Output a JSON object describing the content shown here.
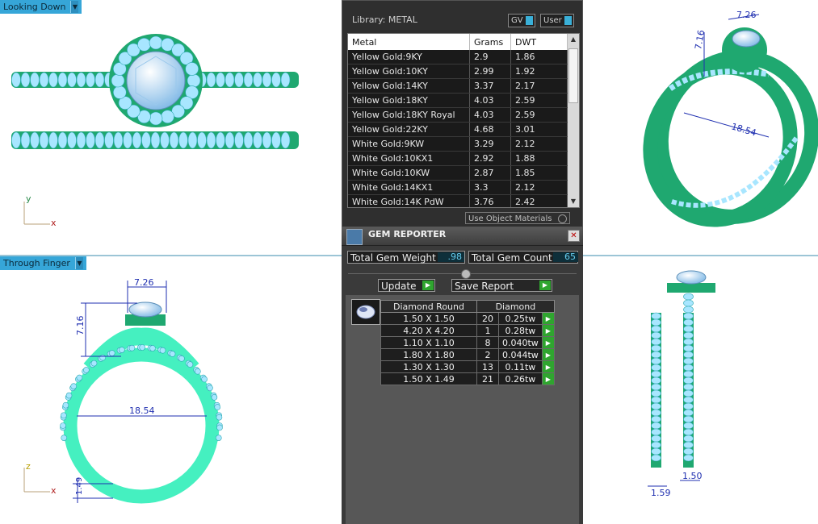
{
  "viewports": {
    "top_left": {
      "label": "Looking Down"
    },
    "bottom_left": {
      "label": "Through Finger"
    },
    "axes_top": {
      "y": "y",
      "x": "x"
    },
    "axes_bottom": {
      "z": "z",
      "x": "x"
    }
  },
  "dimensions": {
    "width": "7.26",
    "height": "7.16",
    "inner": "18.54",
    "thickness": "1.49",
    "band1": "1.59",
    "band2": "1.50"
  },
  "library": {
    "title": "Library: METAL",
    "gv_label": "GV",
    "user_label": "User",
    "columns": [
      "Metal",
      "Grams",
      "DWT"
    ],
    "rows": [
      {
        "metal": "Yellow Gold:9KY",
        "grams": "2.9",
        "dwt": "1.86"
      },
      {
        "metal": "Yellow Gold:10KY",
        "grams": "2.99",
        "dwt": "1.92"
      },
      {
        "metal": "Yellow Gold:14KY",
        "grams": "3.37",
        "dwt": "2.17"
      },
      {
        "metal": "Yellow Gold:18KY",
        "grams": "4.03",
        "dwt": "2.59"
      },
      {
        "metal": "Yellow Gold:18KY Royal",
        "grams": "4.03",
        "dwt": "2.59"
      },
      {
        "metal": "Yellow Gold:22KY",
        "grams": "4.68",
        "dwt": "3.01"
      },
      {
        "metal": "White Gold:9KW",
        "grams": "3.29",
        "dwt": "2.12"
      },
      {
        "metal": "White Gold:10KX1",
        "grams": "2.92",
        "dwt": "1.88"
      },
      {
        "metal": "White Gold:10KW",
        "grams": "2.87",
        "dwt": "1.85"
      },
      {
        "metal": "White Gold:14KX1",
        "grams": "3.3",
        "dwt": "2.12"
      },
      {
        "metal": "White Gold:14K PdW",
        "grams": "3.76",
        "dwt": "2.42"
      }
    ],
    "use_object_materials": "Use Object Materials"
  },
  "gem_reporter": {
    "title": "GEM REPORTER",
    "total_weight_label": "Total Gem Weight",
    "total_weight_value": ".98",
    "total_count_label": "Total Gem Count",
    "total_count_value": "65",
    "update_label": "Update",
    "save_report_label": "Save Report",
    "columns": [
      "Diamond Round",
      "Diamond"
    ],
    "rows": [
      {
        "size": "1.50 X 1.50",
        "count": "20",
        "weight": "0.25tw"
      },
      {
        "size": "4.20 X 4.20",
        "count": "1",
        "weight": "0.28tw"
      },
      {
        "size": "1.10 X 1.10",
        "count": "8",
        "weight": "0.040tw"
      },
      {
        "size": "1.80 X 1.80",
        "count": "2",
        "weight": "0.044tw"
      },
      {
        "size": "1.30 X 1.30",
        "count": "13",
        "weight": "0.11tw"
      },
      {
        "size": "1.50 X 1.49",
        "count": "21",
        "weight": "0.26tw"
      }
    ]
  },
  "colors": {
    "metal_green": "#1fa870",
    "gem_blue": "#bfe3ff",
    "label_blue": "#36a6d8",
    "dim_blue": "#1f2fb0"
  }
}
